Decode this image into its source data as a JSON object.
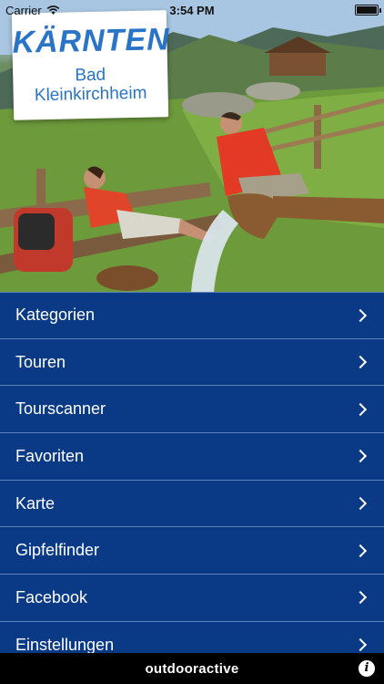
{
  "status_bar": {
    "carrier": "Carrier",
    "time": "3:54 PM",
    "battery_level": 1.0
  },
  "header": {
    "logo_word": "KÄRNTEN",
    "logo_line1": "Bad",
    "logo_line2": "Kleinkirchheim"
  },
  "menu": {
    "items": [
      {
        "label": "Kategorien"
      },
      {
        "label": "Touren"
      },
      {
        "label": "Tourscanner"
      },
      {
        "label": "Favoriten"
      },
      {
        "label": "Karte"
      },
      {
        "label": "Gipfelfinder"
      },
      {
        "label": "Facebook"
      },
      {
        "label": "Einstellungen"
      }
    ]
  },
  "footer": {
    "brand": "outdooractive",
    "info_icon": "info-icon"
  },
  "colors": {
    "menu_bg": "#0a3a86",
    "divider": "#5f82bd",
    "logo_blue": "#2a74c8",
    "footer_bg": "#000000"
  }
}
